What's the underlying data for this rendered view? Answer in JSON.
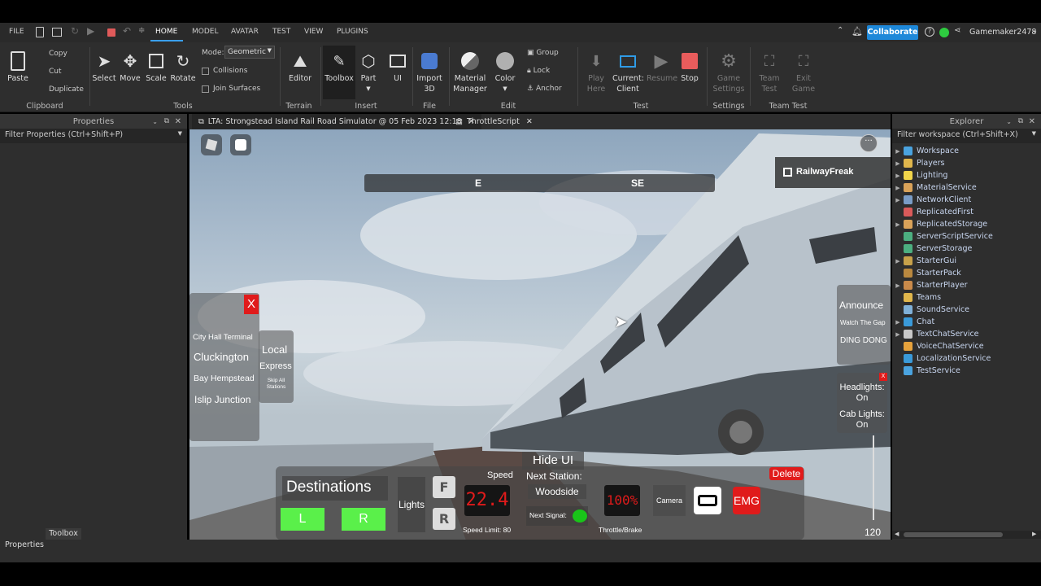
{
  "menubar": {
    "file": "FILE",
    "tabs": [
      "HOME",
      "MODEL",
      "AVATAR",
      "TEST",
      "VIEW",
      "PLUGINS"
    ],
    "active_tab": "HOME",
    "collaborate": "Collaborate",
    "username": "Gamemaker2478"
  },
  "ribbon": {
    "clipboard": {
      "paste": "Paste",
      "copy": "Copy",
      "cut": "Cut",
      "duplicate": "Duplicate",
      "section": "Clipboard"
    },
    "tools": {
      "select": "Select",
      "move": "Move",
      "scale": "Scale",
      "rotate": "Rotate",
      "mode_label": "Mode:",
      "mode_value": "Geometric",
      "collisions": "Collisions",
      "join_surfaces": "Join Surfaces",
      "section": "Tools"
    },
    "terrain": {
      "editor": "Editor",
      "section": "Terrain"
    },
    "insert": {
      "toolbox": "Toolbox",
      "part": "Part",
      "ui": "UI",
      "section": "Insert"
    },
    "file": {
      "import_line1": "Import",
      "import_line2": "3D",
      "section": "File"
    },
    "edit": {
      "material_line1": "Material",
      "material_line2": "Manager",
      "color": "Color",
      "group": "Group",
      "lock": "Lock",
      "anchor": "Anchor",
      "section": "Edit"
    },
    "test": {
      "play_line1": "Play",
      "play_line2": "Here",
      "current_line1": "Current:",
      "current_line2": "Client",
      "resume": "Resume",
      "stop": "Stop",
      "section": "Test"
    },
    "settings": {
      "game_line1": "Game",
      "game_line2": "Settings",
      "section": "Settings"
    },
    "team_test": {
      "team_line1": "Team",
      "team_line2": "Test",
      "exit_line1": "Exit",
      "exit_line2": "Game",
      "section": "Team Test"
    }
  },
  "properties": {
    "title": "Properties",
    "filter": "Filter Properties (Ctrl+Shift+P)"
  },
  "document_tabs": [
    {
      "label": "LTA: Strongstead Island Rail Road Simulator @ 05 Feb 2023 12:18"
    },
    {
      "label": "ThrottleScript"
    }
  ],
  "explorer": {
    "title": "Explorer",
    "filter": "Filter workspace (Ctrl+Shift+X)",
    "items": [
      {
        "label": "Workspace",
        "color": "#4aa3df",
        "expand": true
      },
      {
        "label": "Players",
        "color": "#e0b64c",
        "expand": true
      },
      {
        "label": "Lighting",
        "color": "#f1d54a",
        "expand": true
      },
      {
        "label": "MaterialService",
        "color": "#d9a259",
        "expand": true
      },
      {
        "label": "NetworkClient",
        "color": "#7a9cc6",
        "expand": true
      },
      {
        "label": "ReplicatedFirst",
        "color": "#d95a5a",
        "expand": false
      },
      {
        "label": "ReplicatedStorage",
        "color": "#d9a259",
        "expand": true
      },
      {
        "label": "ServerScriptService",
        "color": "#4caf80",
        "expand": false
      },
      {
        "label": "ServerStorage",
        "color": "#4caf80",
        "expand": false
      },
      {
        "label": "StarterGui",
        "color": "#c7a14a",
        "expand": true
      },
      {
        "label": "StarterPack",
        "color": "#b9883f",
        "expand": false
      },
      {
        "label": "StarterPlayer",
        "color": "#c98a4a",
        "expand": true
      },
      {
        "label": "Teams",
        "color": "#e0b64c",
        "expand": false
      },
      {
        "label": "SoundService",
        "color": "#7fb0d8",
        "expand": false
      },
      {
        "label": "Chat",
        "color": "#3a9ad9",
        "expand": true
      },
      {
        "label": "TextChatService",
        "color": "#c8c8c8",
        "expand": true
      },
      {
        "label": "VoiceChatService",
        "color": "#e6a23c",
        "expand": false
      },
      {
        "label": "LocalizationService",
        "color": "#3a9ad9",
        "expand": false
      },
      {
        "label": "TestService",
        "color": "#4aa3df",
        "expand": false
      }
    ]
  },
  "bottom": {
    "properties_tab": "Properties",
    "toolbox_tab": "Toolbox"
  },
  "game": {
    "compass": [
      "E",
      "SE"
    ],
    "username_badge": "RailwayFreak",
    "destinations_close": "X",
    "destinations": [
      "City Hall Terminal",
      "Cluckington",
      "Bay Hempstead",
      "Islip Junction"
    ],
    "service": {
      "local": "Local",
      "express": "Express",
      "skip_line1": "Skip All",
      "skip_line2": "Stations"
    },
    "announce": {
      "title": "Announce",
      "watch": "Watch The Gap",
      "ding": "DING DONG"
    },
    "lights": {
      "close": "X",
      "headlights_line1": "Headlights:",
      "headlights_line2": "On",
      "cab_line1": "Cab Lights:",
      "cab_line2": "On"
    },
    "hud": {
      "destinations": "Destinations",
      "left": "L",
      "right": "R",
      "lights": "Lights",
      "forward": "F",
      "reverse": "R",
      "speed_label": "Speed",
      "speed_value": "22.4",
      "speed_limit": "Speed Limit: 80",
      "hide_ui": "Hide UI",
      "next_station_label": "Next Station:",
      "next_station": "Woodside",
      "next_signal": "Next Signal:",
      "signal_color": "#19c419",
      "throttle_value": "100%",
      "throttle_label": "Throttle/Brake",
      "camera": "Camera",
      "emg": "EMG",
      "delete": "Delete",
      "side_value": "120"
    }
  }
}
